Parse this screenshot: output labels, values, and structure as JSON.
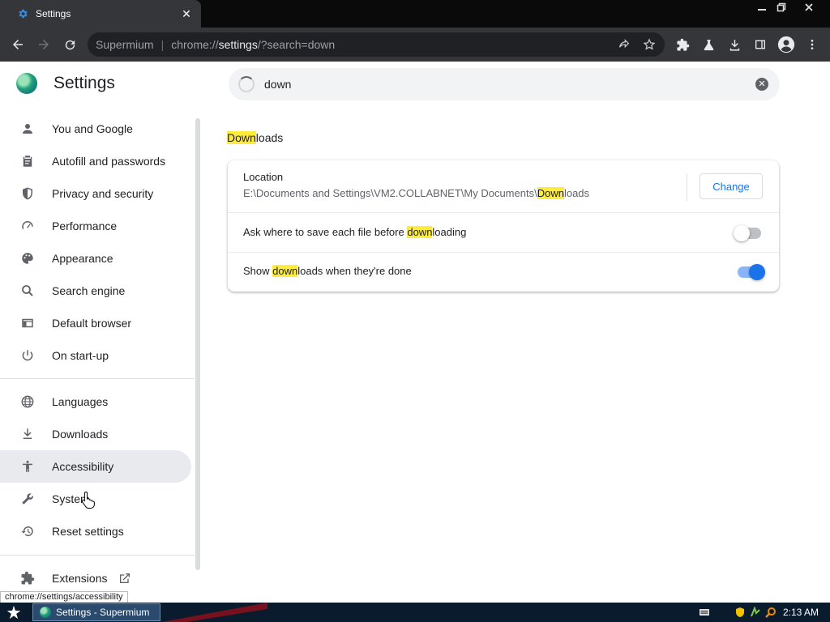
{
  "window": {
    "tab_title": "Settings",
    "tab_icon": "gear-icon",
    "accent_color": "#1a73e8"
  },
  "toolbar": {
    "omnibox_app": "Supermium",
    "omnibox_url_prefix": "chrome://",
    "omnibox_url_host": "settings",
    "omnibox_url_rest": "/?search=down"
  },
  "settings": {
    "title": "Settings",
    "search_value": "down",
    "sidebar": [
      {
        "label": "You and Google",
        "icon": "person-icon"
      },
      {
        "label": "Autofill and passwords",
        "icon": "clipboard-icon"
      },
      {
        "label": "Privacy and security",
        "icon": "shield-icon"
      },
      {
        "label": "Performance",
        "icon": "speedometer-icon"
      },
      {
        "label": "Appearance",
        "icon": "palette-icon"
      },
      {
        "label": "Search engine",
        "icon": "search-icon"
      },
      {
        "label": "Default browser",
        "icon": "browser-icon"
      },
      {
        "label": "On start-up",
        "icon": "power-icon"
      },
      {
        "label": "Languages",
        "icon": "globe-icon"
      },
      {
        "label": "Downloads",
        "icon": "download-icon"
      },
      {
        "label": "Accessibility",
        "icon": "accessibility-icon",
        "active": true
      },
      {
        "label": "System",
        "icon": "wrench-icon"
      },
      {
        "label": "Reset settings",
        "icon": "history-icon"
      },
      {
        "label": "Extensions",
        "icon": "puzzle-icon"
      }
    ],
    "section": {
      "title_highlight": "Down",
      "title_rest": "loads",
      "location_label": "Location",
      "location_path_prefix": "E:\\Documents and Settings\\VM2.COLLABNET\\My Documents\\",
      "location_path_highlight": "Down",
      "location_path_rest": "loads",
      "change_label": "Change",
      "ask_pre": "Ask where to save each file before ",
      "ask_highlight": "down",
      "ask_post": "loading",
      "ask_enabled": false,
      "show_pre": "Show ",
      "show_highlight": "down",
      "show_post": "loads when they're done",
      "show_enabled": true
    }
  },
  "status_bubble": "chrome://settings/accessibility",
  "taskbar": {
    "task_label": "Settings - Supermium",
    "clock": "2:13 AM"
  }
}
